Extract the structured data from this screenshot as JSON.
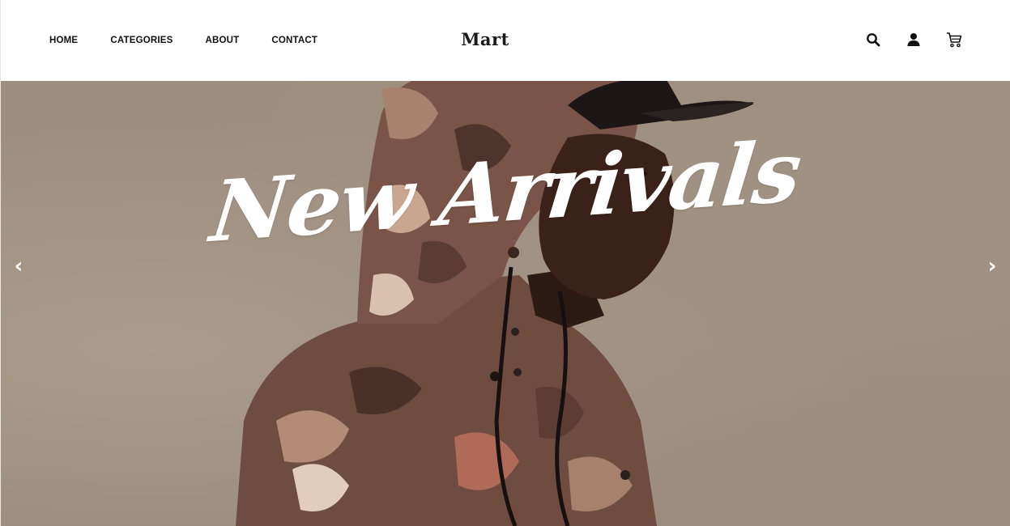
{
  "brand": {
    "logo": "Mart"
  },
  "nav": {
    "items": [
      {
        "label": "HOME"
      },
      {
        "label": "CATEGORIES"
      },
      {
        "label": "ABOUT"
      },
      {
        "label": "CONTACT"
      }
    ]
  },
  "header_icons": [
    "search-icon",
    "user-icon",
    "cart-icon"
  ],
  "hero": {
    "title": "New Arrivals",
    "prev_arrow": "‹",
    "next_arrow": "›"
  },
  "colors": {
    "header_bg": "#ffffff",
    "nav_text": "#111111",
    "hero_bg": "#9d8e80",
    "jacket": "#6b4a3e",
    "hero_text": "#ffffff"
  }
}
